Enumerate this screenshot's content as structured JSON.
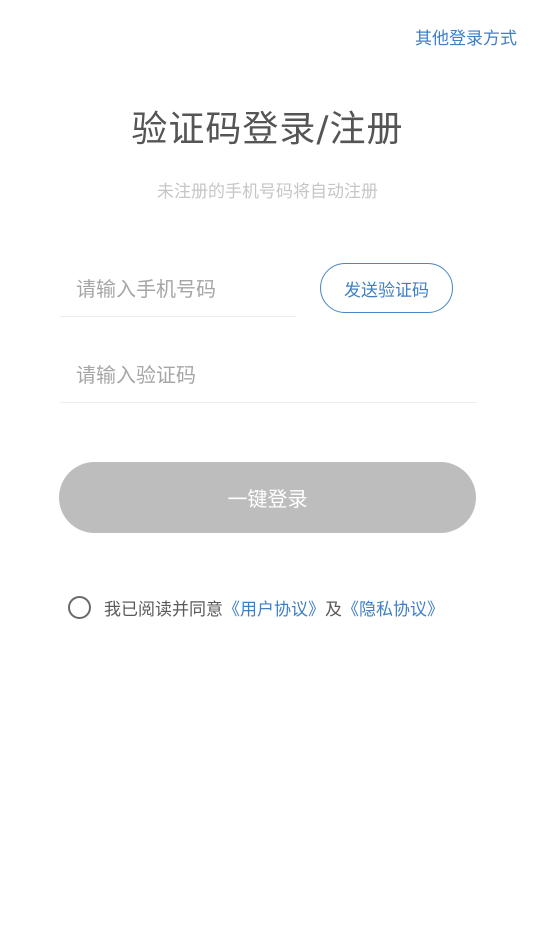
{
  "header": {
    "other_login": "其他登录方式"
  },
  "main": {
    "title": "验证码登录/注册",
    "subtitle": "未注册的手机号码将自动注册"
  },
  "form": {
    "phone_value": "",
    "phone_placeholder": "请输入手机号码",
    "send_code_label": "发送验证码",
    "code_value": "",
    "code_placeholder": "请输入验证码",
    "login_label": "一键登录"
  },
  "agreement": {
    "checked": false,
    "prefix": "我已阅读并同意",
    "user_agreement": "《用户协议》",
    "conjunction": "及",
    "privacy_policy": "《隐私协议》"
  },
  "colors": {
    "link": "#3f7fc7",
    "title": "#555555",
    "subtitle": "#c6c6c6",
    "button_disabled": "#bdbdbd"
  }
}
